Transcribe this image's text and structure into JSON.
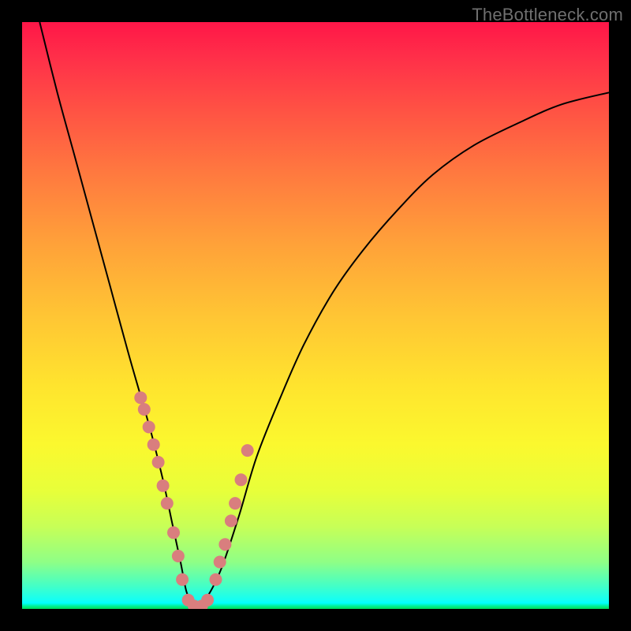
{
  "watermark": "TheBottleneck.com",
  "chart_data": {
    "type": "line",
    "title": "",
    "xlabel": "",
    "ylabel": "",
    "xlim": [
      0,
      100
    ],
    "ylim": [
      0,
      100
    ],
    "grid": false,
    "legend": false,
    "series": [
      {
        "name": "bottleneck-curve",
        "x": [
          3,
          6,
          9,
          12,
          15,
          18,
          20,
          22,
          24,
          25.5,
          27,
          28,
          29,
          30,
          31.5,
          34,
          37,
          40,
          44,
          48,
          53,
          58,
          64,
          70,
          77,
          85,
          92,
          100
        ],
        "y": [
          100,
          88,
          77,
          66,
          55,
          44,
          37,
          30,
          22,
          15,
          8,
          3,
          1,
          1,
          2,
          7,
          16,
          26,
          36,
          45,
          54,
          61,
          68,
          74,
          79,
          83,
          86,
          88
        ]
      }
    ],
    "markers": {
      "name": "highlighted-points",
      "x": [
        20.2,
        20.8,
        21.6,
        22.4,
        23.2,
        24.0,
        24.7,
        25.8,
        26.6,
        27.3,
        28.3,
        29.3,
        30.6,
        31.6,
        33.0,
        33.7,
        34.6,
        35.6,
        36.3,
        37.3,
        38.4
      ],
      "y": [
        36.0,
        34.0,
        31.0,
        28.0,
        25.0,
        21.0,
        18.0,
        13.0,
        9.0,
        5.0,
        1.5,
        0.5,
        0.5,
        1.5,
        5.0,
        8.0,
        11.0,
        15.0,
        18.0,
        22.0,
        27.0
      ]
    },
    "background_gradient": {
      "top": "#ff1648",
      "mid": "#ffe42e",
      "bottom": "#00d95b"
    }
  }
}
